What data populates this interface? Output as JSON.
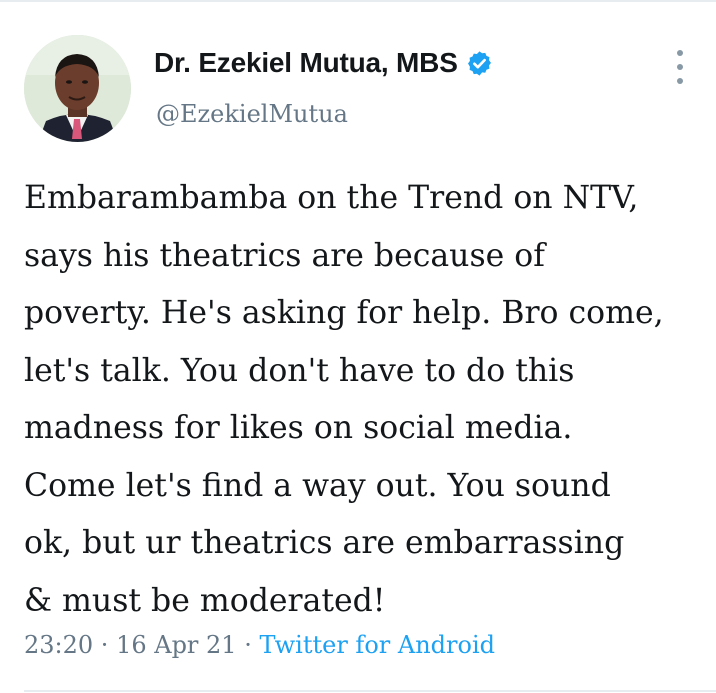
{
  "author": {
    "display_name": "Dr. Ezekiel Mutua, MBS",
    "handle": "@EzekielMutua",
    "verified": true,
    "avatar_icon": "profile-photo"
  },
  "tweet": {
    "lines": [
      "Embarambamba on the Trend on NTV,",
      "says his theatrics are because of",
      "poverty. He's asking for help. Bro come,",
      "let's talk. You don't have to do this",
      "madness for likes on social media.",
      "Come let's find a way out. You sound",
      "ok,  but ur theatrics are embarrassing",
      "& must be moderated!"
    ]
  },
  "meta": {
    "time": "23:20",
    "separator1": " · ",
    "date": "16 Apr 21",
    "separator2": " · ",
    "source": "Twitter for Android"
  },
  "icons": {
    "verified": "verified-badge-icon",
    "more": "more-options-icon"
  },
  "colors": {
    "accent": "#1da1f2",
    "text_primary": "#14171a",
    "text_secondary": "#657786",
    "divider": "#e6ecf0"
  }
}
